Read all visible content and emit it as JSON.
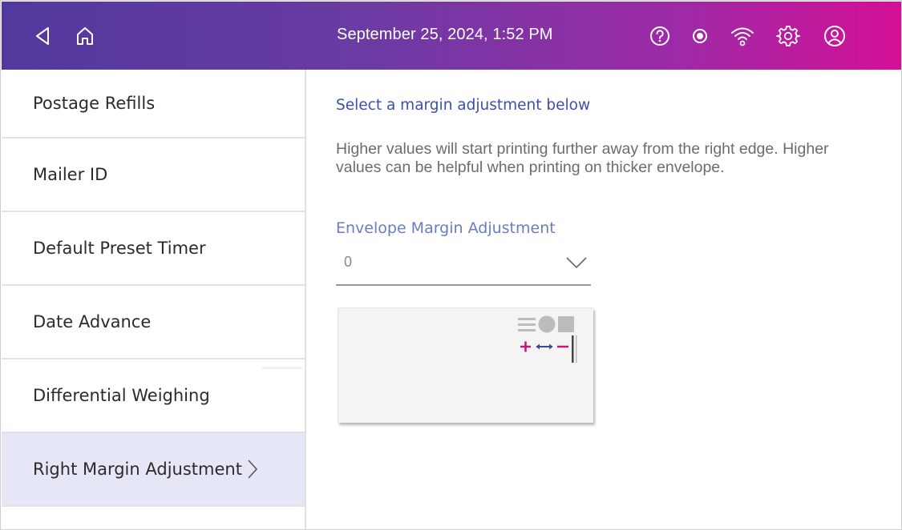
{
  "header": {
    "datetime": "September 25, 2024, 1:52 PM",
    "icons": [
      "back-icon",
      "home-icon",
      "help-icon",
      "status-dot-icon",
      "wifi-icon",
      "settings-icon",
      "account-icon"
    ]
  },
  "sidebar": {
    "items": [
      {
        "label": "Postage Refills"
      },
      {
        "label": "Mailer ID"
      },
      {
        "label": "Default Preset Timer"
      },
      {
        "label": "Date Advance"
      },
      {
        "label": "Differential Weighing"
      },
      {
        "label": "Right Margin Adjustment",
        "active": true
      }
    ]
  },
  "main": {
    "title": "Select a margin adjustment below",
    "description": "Higher values will start printing further away from the right edge. Higher values can be helpful when printing on thicker envelope.",
    "field_label": "Envelope Margin Adjustment",
    "field_value": "0"
  },
  "colors": {
    "header_gradient_start": "#51399e",
    "header_gradient_end": "#d40f96",
    "accent_blue": "#3b4fae",
    "field_label": "#6d7bc0",
    "active_item_bg": "#e5e7f6",
    "plus_minus": "#c8127e",
    "arrow": "#3a4a8c"
  }
}
